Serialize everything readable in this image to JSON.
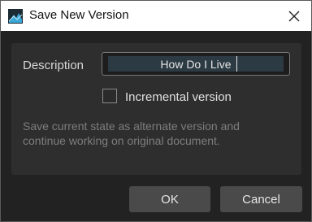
{
  "window": {
    "title": "Save New Version",
    "close_icon": "close-icon",
    "app_icon": "app-logo-icon"
  },
  "form": {
    "description_label": "Description",
    "description_value": "How Do I Live",
    "incremental_label": "Incremental version",
    "incremental_checked": false,
    "help_text": "Save current state as alternate version and continue working on original document."
  },
  "buttons": {
    "ok_label": "OK",
    "cancel_label": "Cancel"
  },
  "colors": {
    "background": "#222222",
    "panel": "#2e2e2e",
    "button": "#4a4a4a",
    "input_selection": "#2c3a44"
  }
}
